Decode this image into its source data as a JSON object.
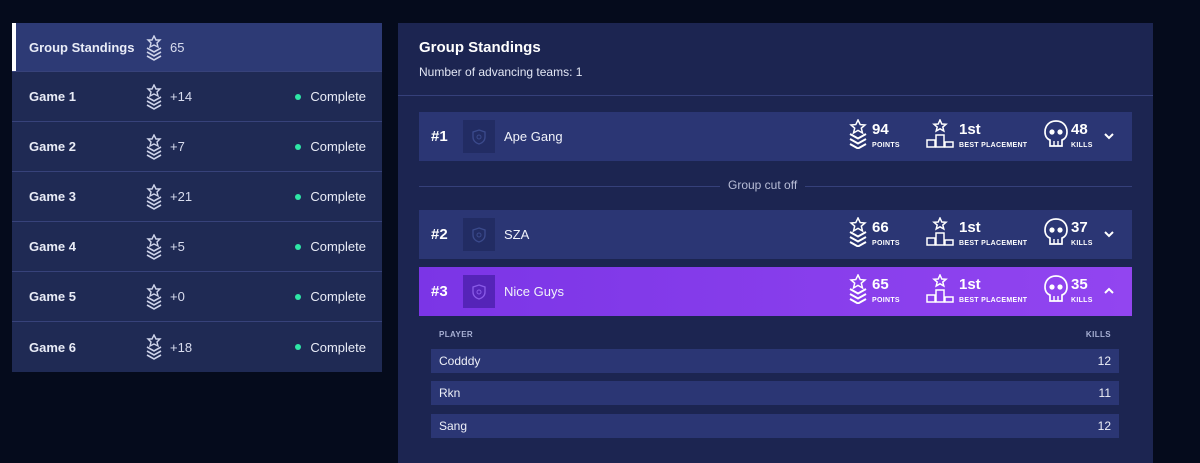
{
  "sidebar": {
    "items": [
      {
        "label": "Group Standings",
        "points": "65",
        "status": "",
        "active": true
      },
      {
        "label": "Game 1",
        "points": "+14",
        "status": "Complete"
      },
      {
        "label": "Game 2",
        "points": "+7",
        "status": "Complete"
      },
      {
        "label": "Game 3",
        "points": "+21",
        "status": "Complete"
      },
      {
        "label": "Game 4",
        "points": "+5",
        "status": "Complete"
      },
      {
        "label": "Game 5",
        "points": "+0",
        "status": "Complete"
      },
      {
        "label": "Game 6",
        "points": "+18",
        "status": "Complete"
      }
    ],
    "status_color": "#2ee5a6"
  },
  "panel": {
    "title": "Group Standings",
    "subtitle": "Number of advancing teams: 1",
    "cutoff_label": "Group cut off",
    "stat_captions": {
      "points": "POINTS",
      "placement": "BEST PLACEMENT",
      "kills": "KILLS"
    },
    "teams": [
      {
        "rank": "#1",
        "name": "Ape Gang",
        "points": "94",
        "placement": "1st",
        "kills": "48",
        "expanded": false
      },
      {
        "rank": "#2",
        "name": "SZA",
        "points": "66",
        "placement": "1st",
        "kills": "37",
        "expanded": false
      },
      {
        "rank": "#3",
        "name": "Nice Guys",
        "points": "65",
        "placement": "1st",
        "kills": "35",
        "expanded": true
      }
    ],
    "players_header": {
      "player": "PLAYER",
      "kills": "KILLS"
    },
    "players": [
      {
        "name": "Codddy",
        "kills": "12"
      },
      {
        "name": "Rkn",
        "kills": "11"
      },
      {
        "name": "Sang",
        "kills": "12"
      }
    ],
    "expanded_color": "#8a3ff0"
  }
}
